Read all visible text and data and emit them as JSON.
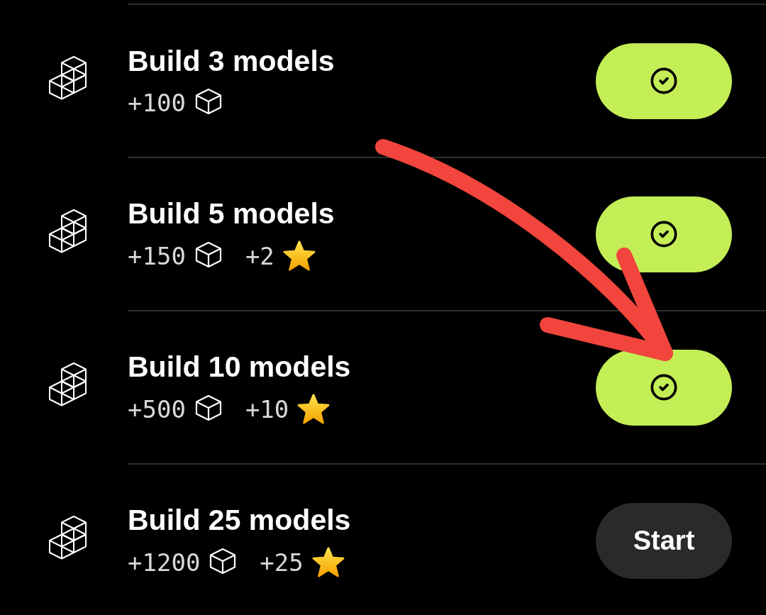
{
  "tasks": [
    {
      "title": "Build 3 models",
      "points": "+100",
      "completed": true
    },
    {
      "title": "Build 5 models",
      "points": "+150",
      "stars": "+2",
      "completed": true
    },
    {
      "title": "Build 10 models",
      "points": "+500",
      "stars": "+10",
      "completed": true
    },
    {
      "title": "Build 25 models",
      "points": "+1200",
      "stars": "+25",
      "completed": false,
      "button_label": "Start"
    }
  ],
  "annotation": {
    "kind": "arrow"
  }
}
